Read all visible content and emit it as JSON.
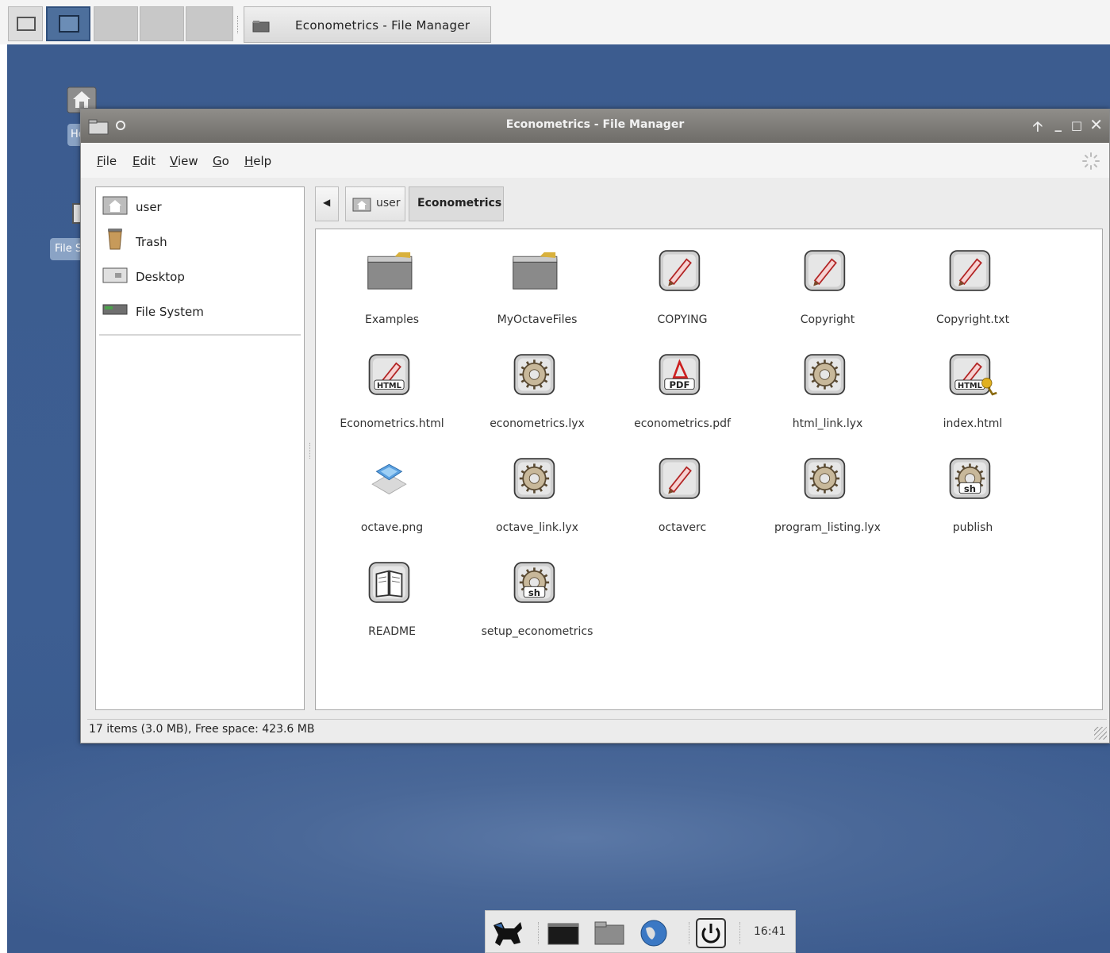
{
  "taskbar": {
    "task_title": "Econometrics - File Manager"
  },
  "desktop": {
    "home_label_partial": "Ho",
    "filesystem_label_partial": "File S"
  },
  "window": {
    "title": "Econometrics - File Manager",
    "menu": [
      {
        "label": "File",
        "mnemonic": "F",
        "rest": "ile"
      },
      {
        "label": "Edit",
        "mnemonic": "E",
        "rest": "dit"
      },
      {
        "label": "View",
        "mnemonic": "V",
        "rest": "iew"
      },
      {
        "label": "Go",
        "mnemonic": "G",
        "rest": "o"
      },
      {
        "label": "Help",
        "mnemonic": "H",
        "rest": "elp"
      }
    ],
    "side_pane": [
      {
        "label": "user",
        "icon": "home-icon"
      },
      {
        "label": "Trash",
        "icon": "trash-icon"
      },
      {
        "label": "Desktop",
        "icon": "desktop-icon"
      },
      {
        "label": "File System",
        "icon": "drive-icon"
      }
    ],
    "breadcrumb": {
      "user": "user",
      "current": "Econometrics"
    },
    "files": [
      {
        "name": "Examples",
        "icon": "folder-icon"
      },
      {
        "name": "MyOctaveFiles",
        "icon": "folder-icon"
      },
      {
        "name": "COPYING",
        "icon": "text-file-icon"
      },
      {
        "name": "Copyright",
        "icon": "text-file-icon"
      },
      {
        "name": "Copyright.txt",
        "icon": "text-file-icon"
      },
      {
        "name": "Econometrics.html",
        "icon": "html-file-icon"
      },
      {
        "name": "econometrics.lyx",
        "icon": "gear-file-icon"
      },
      {
        "name": "econometrics.pdf",
        "icon": "pdf-file-icon"
      },
      {
        "name": "html_link.lyx",
        "icon": "gear-file-icon"
      },
      {
        "name": "index.html",
        "icon": "html-link-file-icon"
      },
      {
        "name": "octave.png",
        "icon": "image-file-icon"
      },
      {
        "name": "octave_link.lyx",
        "icon": "gear-file-icon"
      },
      {
        "name": "octaverc",
        "icon": "text-file-icon"
      },
      {
        "name": "program_listing.lyx",
        "icon": "gear-file-icon"
      },
      {
        "name": "publish",
        "icon": "shell-script-icon"
      },
      {
        "name": "README",
        "icon": "readme-book-icon"
      },
      {
        "name": "setup_econometrics",
        "icon": "shell-script-icon"
      }
    ],
    "status": "17 items (3.0 MB), Free space: 423.6 MB"
  },
  "dock": {
    "clock": "16:41"
  }
}
